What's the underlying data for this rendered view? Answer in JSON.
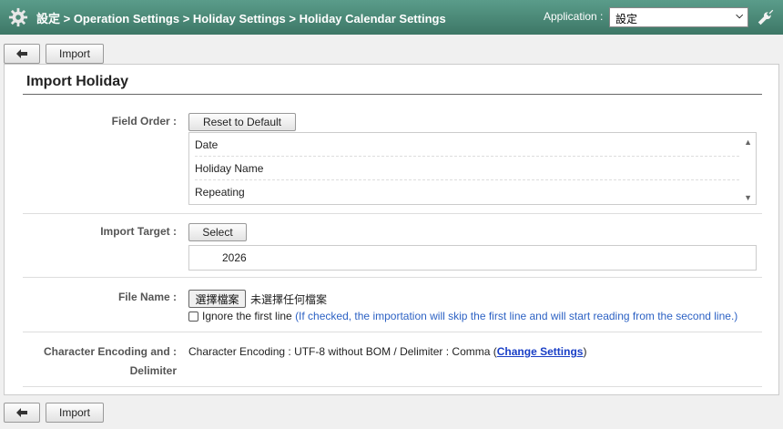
{
  "header": {
    "breadcrumb": "設定 > Operation Settings > Holiday Settings > Holiday Calendar Settings",
    "application_label": "Application :",
    "application_value": "設定"
  },
  "toolbar": {
    "import_label": "Import"
  },
  "panel": {
    "title": "Import Holiday",
    "field_order": {
      "label": "Field Order :",
      "reset_label": "Reset to Default",
      "items": [
        "Date",
        "Holiday Name",
        "Repeating"
      ]
    },
    "import_target": {
      "label": "Import Target :",
      "select_label": "Select",
      "value": "2026"
    },
    "file_name": {
      "label": "File Name :",
      "choose_label": "選擇檔案",
      "none_text": "未選擇任何檔案",
      "ignore_label": "Ignore the first line",
      "ignore_note": "(If checked, the importation will skip the first line and will start reading from the second line.)"
    },
    "encoding": {
      "label_line1": "Character Encoding and :",
      "label_line2": "Delimiter",
      "text_prefix": "Character Encoding : UTF-8 without BOM / Delimiter : Comma (",
      "link_text": "Change Settings",
      "text_suffix": ")"
    }
  },
  "colors": {
    "header_bg": "#4a8a77",
    "link": "#1a3fc6",
    "note": "#2d62c4"
  }
}
